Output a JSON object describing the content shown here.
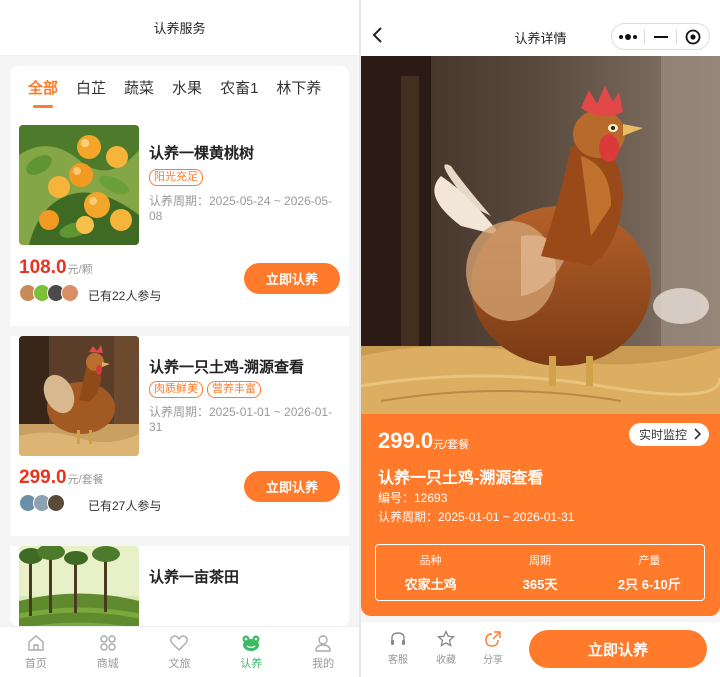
{
  "left": {
    "header_title": "认养服务",
    "tabs": [
      {
        "label": "全部",
        "active": true
      },
      {
        "label": "白芷"
      },
      {
        "label": "蔬菜"
      },
      {
        "label": "水果"
      },
      {
        "label": "农畜1"
      },
      {
        "label": "林下养"
      }
    ],
    "items": [
      {
        "title": "认养一棵黄桃树",
        "tags": [
          "阳光充足"
        ],
        "period": "认养周期：2025-05-24 ~ 2026-05-08",
        "price": "108.0",
        "unit": "元/颗",
        "joined": "已有22人参与",
        "button": "立即认养"
      },
      {
        "title": "认养一只土鸡-溯源查看",
        "tags": [
          "肉质鲜美",
          "营养丰富"
        ],
        "period": "认养周期：2025-01-01 ~ 2026-01-31",
        "price": "299.0",
        "unit": "元/套餐",
        "joined": "已有27人参与",
        "button": "立即认养"
      },
      {
        "title": "认养一亩茶田"
      }
    ],
    "nav": [
      {
        "label": "首页",
        "icon": "home-icon"
      },
      {
        "label": "商城",
        "icon": "grid-icon"
      },
      {
        "label": "文旅",
        "icon": "heart-icon"
      },
      {
        "label": "认养",
        "icon": "frog-icon",
        "active": true
      },
      {
        "label": "我的",
        "icon": "user-icon"
      }
    ]
  },
  "right": {
    "header_title": "认养详情",
    "price": "299.0",
    "unit": "元/套餐",
    "monitor_label": "实时监控",
    "title": "认养一只土鸡-溯源查看",
    "serial": "编号：12693",
    "period": "认养周期：2025-01-01 ~ 2026-01-31",
    "specs": [
      {
        "key": "品种",
        "value": "农家土鸡"
      },
      {
        "key": "周期",
        "value": "365天"
      },
      {
        "key": "产量",
        "value": "2只 6-10斤"
      }
    ],
    "actions": [
      {
        "label": "客服",
        "icon": "headset-icon"
      },
      {
        "label": "收藏",
        "icon": "star-icon"
      },
      {
        "label": "分享",
        "icon": "share-icon"
      }
    ],
    "buy_label": "立即认养"
  },
  "colors": {
    "accent": "#ff7a2a",
    "price_red": "#e8331e",
    "nav_active": "#3cba64"
  }
}
